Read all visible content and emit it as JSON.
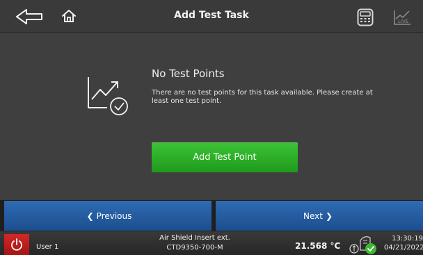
{
  "header": {
    "title": "Add Test Task",
    "back_icon": "arrow-left-icon",
    "home_icon": "home-icon",
    "calculator_icon": "calculator-icon",
    "live_icon": "live-chart-icon",
    "live_label": "LIVE"
  },
  "main": {
    "empty_icon": "chart-check-icon",
    "empty_title": "No Test Points",
    "empty_message": "There are no test points for this task available. Please create at least one test point.",
    "add_button_label": "Add Test Point"
  },
  "navigation": {
    "previous_label": "Previous",
    "previous_chevron": "❮",
    "next_label": "Next",
    "next_chevron": "❯"
  },
  "status_bar": {
    "power_icon": "power-icon",
    "user": "User 1",
    "device_line1": "Air Shield Insert ext.",
    "device_line2": "CTD9350-700-M",
    "temperature": "21.568 °C",
    "connection_icon": "sensor-connected-icon",
    "time": "13:30:19",
    "date": "04/21/2022"
  },
  "colors": {
    "add_button": "#2fb22a",
    "nav_button": "#2560a6",
    "power_button": "#c41f1f",
    "background": "#3f3f3f"
  }
}
